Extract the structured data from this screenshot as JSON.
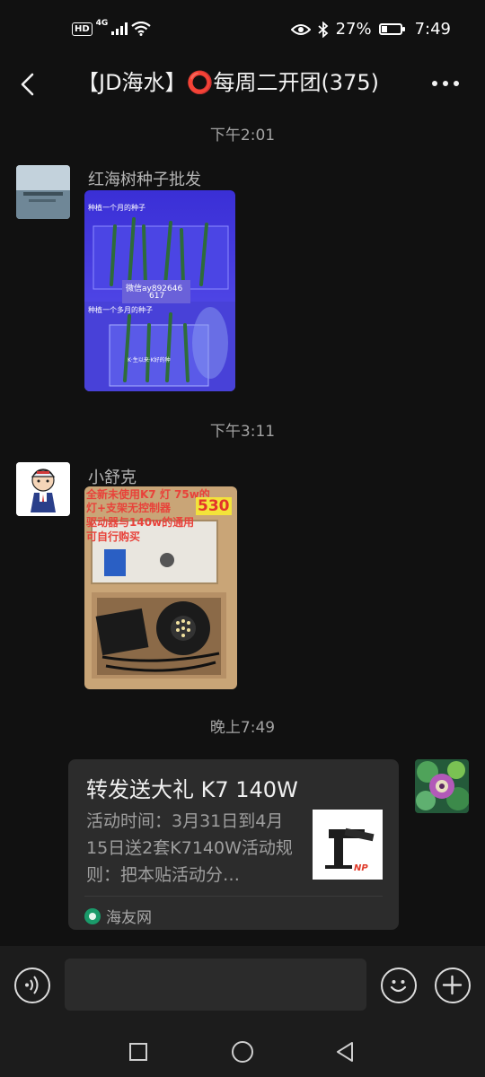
{
  "status_bar": {
    "hd": "HD",
    "network": "4G",
    "battery": "27%",
    "battery_level": 0.27,
    "time": "7:49"
  },
  "header": {
    "title": "【JD海水】⭕每周二开团(375)"
  },
  "messages": [
    {
      "timestamp": "下午2:01",
      "sender": "红海树种子批发",
      "image_text": [
        "种植一个月的种子",
        "微信ay892646",
        "617",
        "种植一个多月的种子",
        "K·生以来·K好的种"
      ]
    },
    {
      "timestamp": "下午3:11",
      "sender": "小舒克",
      "image_text": [
        "全新未使用K7 灯 75w的",
        "灯+支架无控制器",
        "530",
        "驱动器与140w的通用",
        "可自行购买"
      ]
    }
  ],
  "outgoing": {
    "timestamp": "晚上7:49",
    "card": {
      "title": "转发送大礼 K7 140W",
      "description": "活动时间：3月31日到4月15日送2套K7140W活动规则：把本贴活动分…",
      "source": "海友网",
      "thumb_logo": "NP"
    }
  },
  "input_bar": {
    "placeholder": ""
  },
  "colors": {
    "background": "#111111",
    "card": "#2c2c2c",
    "bar": "#1c1c1c",
    "title_text": "#f2f2f2",
    "muted_text": "#a3a3a3"
  },
  "icons": [
    "hd-badge-icon",
    "signal-icon",
    "wifi-icon",
    "eye-icon",
    "bluetooth-icon",
    "battery-icon",
    "back-arrow-icon",
    "more-icon",
    "voice-icon",
    "emoji-icon",
    "plus-icon",
    "square-recents-icon",
    "circle-home-icon",
    "triangle-back-icon"
  ]
}
